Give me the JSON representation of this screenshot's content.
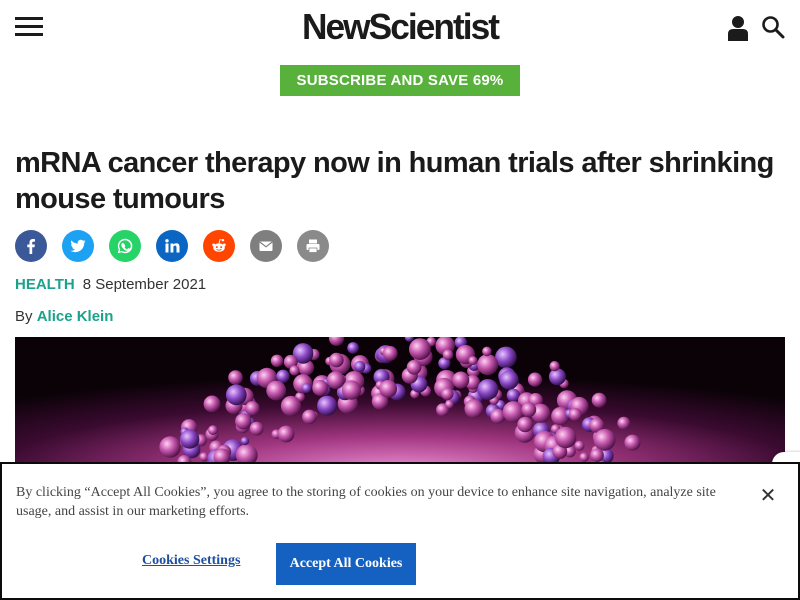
{
  "header": {
    "menu_icon": "hamburger-menu-icon",
    "logo_text": "NewScientist",
    "user_icon": "user-account-icon",
    "search_icon": "search-icon",
    "subscribe_label": "SUBSCRIBE AND SAVE 69%"
  },
  "article": {
    "title": "mRNA cancer therapy now in human trials after shrinking mouse tumours",
    "category": "HEALTH",
    "date": "8 September 2021",
    "by_prefix": "By",
    "author": "Alice Klein",
    "share": [
      {
        "name": "facebook-icon",
        "color": "#3b5998"
      },
      {
        "name": "twitter-icon",
        "color": "#1da1f2"
      },
      {
        "name": "whatsapp-icon",
        "color": "#25d366"
      },
      {
        "name": "linkedin-icon",
        "color": "#0a66c2"
      },
      {
        "name": "reddit-icon",
        "color": "#ff4500"
      },
      {
        "name": "email-icon",
        "color": "#7f7f7f"
      },
      {
        "name": "print-icon",
        "color": "#8a8a8a"
      }
    ]
  },
  "cookie_banner": {
    "text": "By clicking “Accept All Cookies”, you agree to the storing of cookies on your device to enhance site navigation, analyze site usage, and assist in our marketing efforts.",
    "settings_label": "Cookies Settings",
    "accept_label": "Accept All Cookies",
    "close_label": "✕"
  },
  "colors": {
    "brand_green": "#57b13a",
    "link_teal": "#1aa38a",
    "accept_blue": "#1561c1"
  }
}
